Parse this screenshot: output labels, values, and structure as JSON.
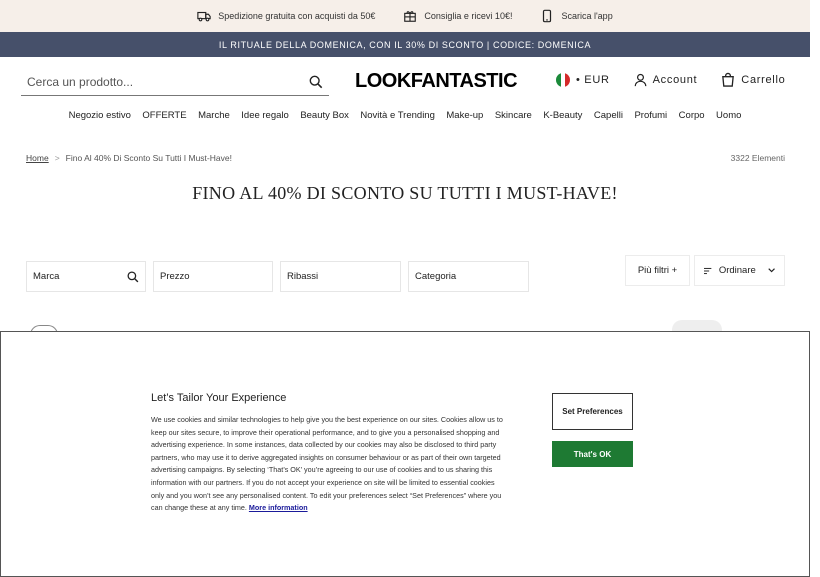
{
  "promo": {
    "shipping": "Spedizione gratuita con acquisti da 50€",
    "referral": "Consiglia e ricevi 10€!",
    "app": "Scarica l'app"
  },
  "announcement": "IL RITUALE DELLA DOMENICA, CON IL 30% DI SCONTO | CODICE: DOMENICA",
  "header": {
    "search_placeholder": "Cerca un prodotto...",
    "logo": "LOOKFANTASTIC",
    "currency": "• EUR",
    "account": "Account",
    "cart": "Carrello"
  },
  "nav": [
    "Negozio estivo",
    "OFFERTE",
    "Marche",
    "Idee regalo",
    "Beauty Box",
    "Novità e Trending",
    "Make-up",
    "Skincare",
    "K-Beauty",
    "Capelli",
    "Profumi",
    "Corpo",
    "Uomo"
  ],
  "breadcrumb": {
    "home": "Home",
    "separator": ">",
    "current": "Fino Al 40% Di Sconto Su Tutti I Must-Have!"
  },
  "item_count": "3322 Elementi",
  "page_title": "FINO AL 40% DI SCONTO SU TUTTI I MUST-HAVE!",
  "filters": {
    "brand": "Marca",
    "price": "Prezzo",
    "discounts": "Ribassi",
    "category": "Categoria",
    "more": "Più filtri +",
    "sort": "Ordinare"
  },
  "cookie": {
    "title": "Let’s Tailor Your Experience",
    "body": "We use cookies and similar technologies to help give you the best experience on our sites. Cookies allow us to keep our sites secure, to improve their operational performance, and to give you a personalised shopping and advertising experience. In some instances, data collected by our cookies may also be disclosed to third party partners, who may use it to derive aggregated insights on consumer behaviour or as part of their own targeted advertising campaigns. By selecting ‘That’s OK’ you’re agreeing to our use of cookies and to us sharing this information with our partners. If you do not accept your experience on site will be limited to essential cookies only and you won’t see any personalised content. To edit your preferences select “Set Preferences” where you can change these at any time.",
    "more_link": "More information",
    "set_preferences": "Set Preferences",
    "accept": "That's OK"
  },
  "colors": {
    "promo_bg": "#f6efe9",
    "announce_bg": "#46506a",
    "accept_green": "#1e7a33"
  }
}
